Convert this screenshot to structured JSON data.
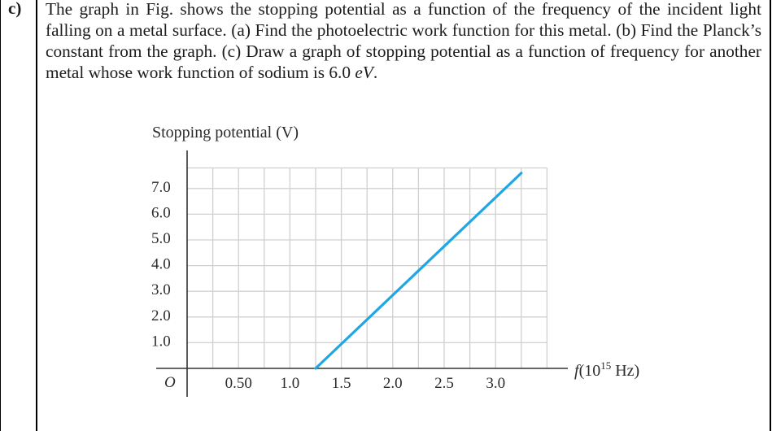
{
  "item_label": "c)",
  "question": {
    "text_before_unit": "The graph in Fig. shows the stopping potential as a function of the frequency of the incident light falling on a metal surface. (a) Find the photoelectric work function for this metal. (b) Find the Planck’s constant from the graph. (c) Draw a graph of stopping potential as a function of frequency for another metal whose work function of sodium is 6.0 ",
    "unit": "eV",
    "end": "."
  },
  "chart_data": {
    "type": "line",
    "title": "",
    "ylabel": "Stopping potential (V)",
    "xlabel_prefix": "f(10",
    "xlabel_exponent": "15",
    "xlabel_suffix": " Hz)",
    "origin_label": "O",
    "xlim": [
      0,
      3.5
    ],
    "ylim": [
      0,
      8
    ],
    "grid": true,
    "x_grid_step": 0.25,
    "y_grid_step": 1.0,
    "x_ticks": [
      {
        "value": 0.5,
        "label": "0.50"
      },
      {
        "value": 1.0,
        "label": "1.0"
      },
      {
        "value": 1.5,
        "label": "1.5"
      },
      {
        "value": 2.0,
        "label": "2.0"
      },
      {
        "value": 2.5,
        "label": "2.5"
      },
      {
        "value": 3.0,
        "label": "3.0"
      }
    ],
    "y_ticks": [
      {
        "value": 1,
        "label": "1.0"
      },
      {
        "value": 2,
        "label": "2.0"
      },
      {
        "value": 3,
        "label": "3.0"
      },
      {
        "value": 4,
        "label": "4.0"
      },
      {
        "value": 5,
        "label": "5.0"
      },
      {
        "value": 6,
        "label": "6.0"
      },
      {
        "value": 7,
        "label": "7.0"
      }
    ],
    "series": [
      {
        "name": "stopping potential",
        "color": "#1ea7e4",
        "x": [
          1.25,
          3.25
        ],
        "y": [
          0.0,
          7.6
        ]
      }
    ]
  }
}
